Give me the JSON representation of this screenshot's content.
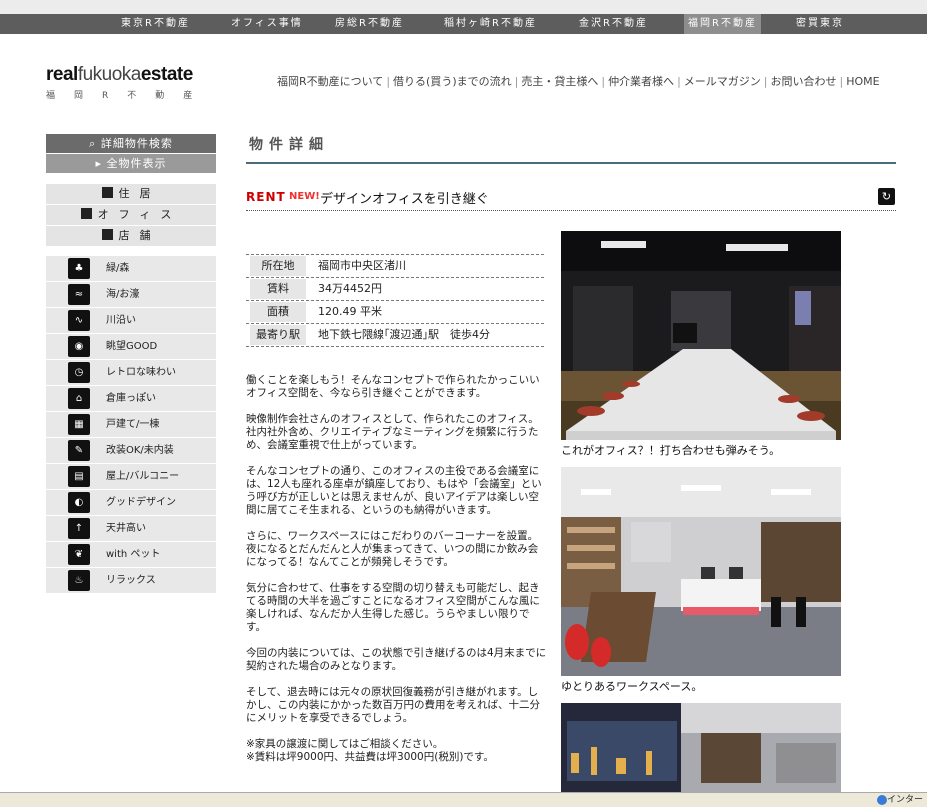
{
  "top_nav": [
    "東京R不動産",
    "オフィス事情",
    "房総R不動産",
    "稲村ヶ崎R不動産",
    "金沢R不動産",
    "福岡R不動産",
    "密買東京"
  ],
  "top_nav_active": "福岡R不動産",
  "logo": {
    "part1": "real",
    "part2": "fukuoka",
    "part3": "estate",
    "sub": "福岡R不動産"
  },
  "header_nav": [
    "福岡R不動産について",
    "借りる(買う)までの流れ",
    "売主・貸主様へ",
    "仲介業者様へ",
    "メールマガジン",
    "お問い合わせ",
    "HOME"
  ],
  "sidebar": {
    "search": "詳細物件検索",
    "all": "全物件表示",
    "categories": [
      "住居",
      "オフィス",
      "店舗"
    ],
    "tags": [
      "緑/森",
      "海/お濠",
      "川沿い",
      "眺望GOOD",
      "レトロな味わい",
      "倉庫っぽい",
      "戸建て/一棟",
      "改装OK/未内装",
      "屋上/バルコニー",
      "グッドデザイン",
      "天井高い",
      "with ペット",
      "リラックス"
    ]
  },
  "section_title": "物件詳細",
  "property": {
    "type": "RENT",
    "new": "NEW!",
    "title": "デザインオフィスを引き継ぐ",
    "info": [
      {
        "k": "所在地",
        "v": "福岡市中央区渚川"
      },
      {
        "k": "賃料",
        "v": "34万4452円"
      },
      {
        "k": "面積",
        "v": "120.49 平米"
      },
      {
        "k": "最寄り駅",
        "v": "地下鉄七隈線｢渡辺通｣駅　徒歩4分"
      }
    ],
    "paragraphs": [
      "働くことを楽しもう！そんなコンセプトで作られたかっこいいオフィス空間を、今なら引き継ぐことができます。",
      "映像制作会社さんのオフィスとして、作られたこのオフィス。社内社外含め、クリエイティブなミーティングを頻繁に行うため、会議室重視で仕上がっています。",
      "そんなコンセプトの通り、このオフィスの主役である会議室には、12人も座れる座卓が鎮座しており、もはや「会議室」という呼び方が正しいとは思えませんが、良いアイデアは楽しい空間に居てこそ生まれる、というのも納得がいきます。",
      "さらに、ワークスペースにはこだわりのバーコーナーを設置。夜になるとだんだんと人が集まってきて、いつの間にか飲み会になってる！なんてことが頻発しそうです。",
      "気分に合わせて、仕事をする空間の切り替えも可能だし、起きてる時間の大半を過ごすことになるオフィス空間がこんな風に楽しければ、なんだか人生得した感じ。うらやましい限りです。",
      "今回の内装については、この状態で引き継げるのは4月末までに契約された場合のみとなります。",
      "そして、退去時には元々の原状回復義務が引き継がれます。しかし、この内装にかかった数百万円の費用を考えれば、十二分にメリットを享受できるでしょう。",
      "※家具の譲渡に関してはご相談ください。\n※賃料は坪9000円、共益費は坪3000円(税別)です。"
    ],
    "captions": [
      "これがオフィス？！打ち合わせも弾みそう。",
      "ゆとりあるワークスペース。"
    ]
  },
  "status": "インター"
}
